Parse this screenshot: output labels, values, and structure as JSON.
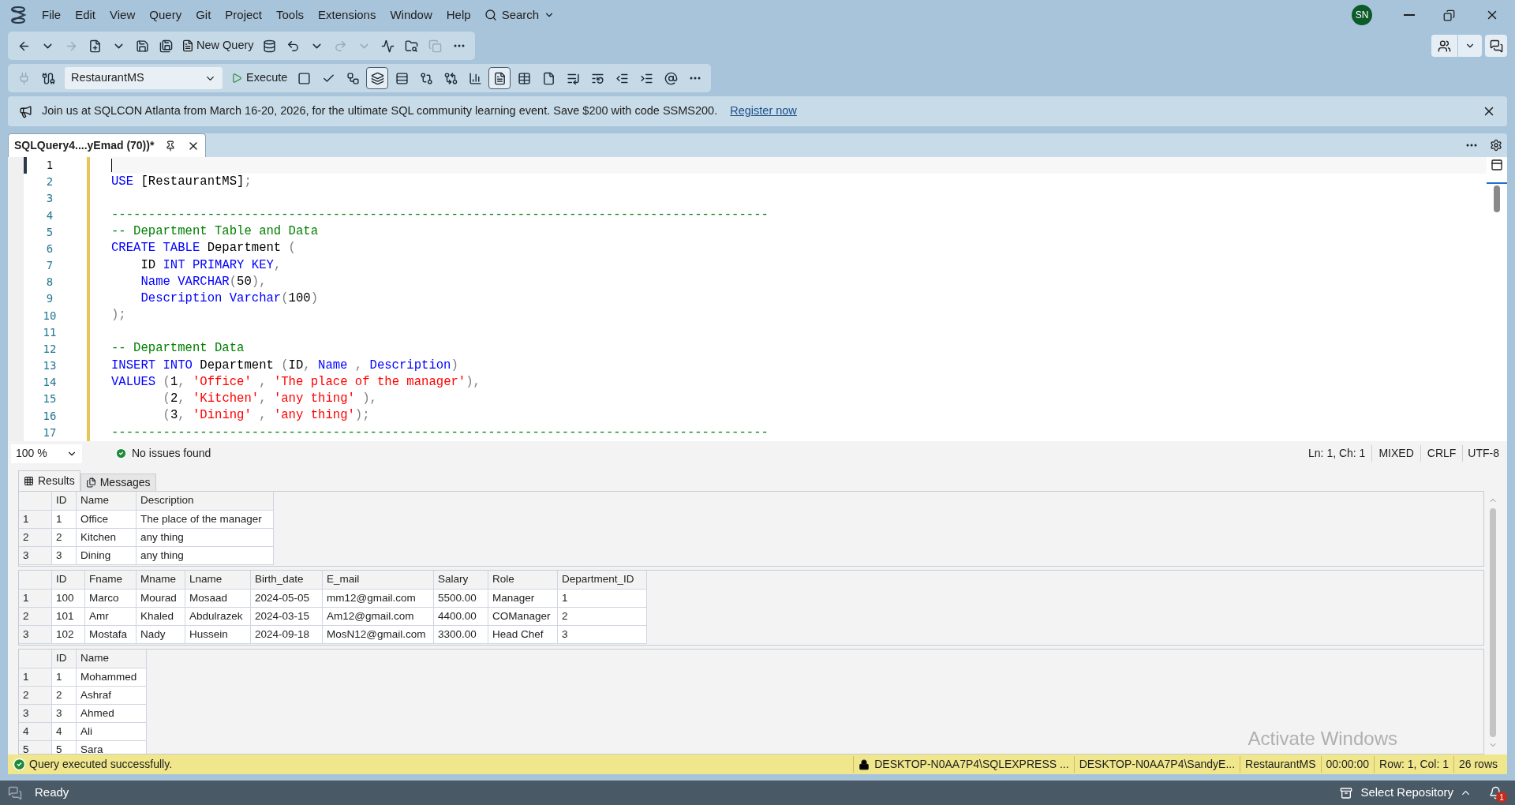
{
  "menu": {
    "items": [
      "File",
      "Edit",
      "View",
      "Query",
      "Git",
      "Project",
      "Tools",
      "Extensions",
      "Window",
      "Help"
    ],
    "search": "Search",
    "avatar": "SN"
  },
  "toolbar_1": {
    "buttons": [
      {
        "disabled": false
      },
      {
        "disabled": false
      },
      {
        "disabled": true
      },
      {
        "disabled": false
      },
      {
        "disabled": false
      },
      {
        "disabled": false
      },
      {
        "disabled": false
      }
    ],
    "new_query": "New Query",
    "after": [
      {
        "disabled": false
      },
      {
        "disabled": false
      },
      {
        "disabled": false
      },
      {
        "disabled": true
      },
      {
        "disabled": true
      },
      {
        "disabled": false
      },
      {
        "disabled": false
      },
      {
        "disabled": true
      },
      {
        "disabled": false
      }
    ]
  },
  "toolbar_2": {
    "database": "RestaurantMS",
    "execute": "Execute",
    "buttons": [
      {
        "selected": false
      },
      {
        "selected": false
      },
      {
        "selected": false
      },
      {
        "selected": true
      },
      {
        "selected": false
      },
      {
        "selected": false
      },
      {
        "selected": false
      },
      {
        "selected": false
      },
      {
        "selected": true
      },
      {
        "selected": false
      },
      {
        "selected": false
      },
      {
        "selected": false
      },
      {
        "selected": false
      },
      {
        "selected": false
      },
      {
        "selected": false
      },
      {
        "selected": false
      }
    ]
  },
  "banner": {
    "text": "Join us at SQLCON Atlanta from March 16-20, 2026, for the ultimate SQL community learning event. Save $200 with code SSMS200.",
    "link": "Register now"
  },
  "document_tab": {
    "title": "SQLQuery4....yEmad (70))*",
    "selected": true
  },
  "editor": {
    "lines": [
      {
        "n": "1",
        "current": true
      },
      {
        "n": "2",
        "current": false,
        "tokens": [
          {
            "kind": "keyword",
            "t": "USE"
          },
          {
            "kind": "plain",
            "t": " [RestaurantMS]"
          },
          {
            "kind": "punct",
            "t": ";"
          }
        ]
      },
      {
        "n": "3",
        "current": false
      },
      {
        "n": "4",
        "current": false,
        "tokens": [
          {
            "kind": "comment",
            "t": "-----------------------------------------------------------------------------------------"
          }
        ]
      },
      {
        "n": "5",
        "current": false,
        "tokens": [
          {
            "kind": "comment",
            "t": "-- Department Table and Data"
          }
        ]
      },
      {
        "n": "6",
        "current": false,
        "tokens": [
          {
            "kind": "keyword",
            "t": "CREATE TABLE"
          },
          {
            "kind": "plain",
            "t": " Department "
          },
          {
            "kind": "punct",
            "t": "("
          }
        ]
      },
      {
        "n": "7",
        "current": false,
        "tokens": [
          {
            "kind": "plain",
            "t": "    ID "
          },
          {
            "kind": "keyword",
            "t": "INT PRIMARY KEY"
          },
          {
            "kind": "punct",
            "t": ","
          }
        ]
      },
      {
        "n": "8",
        "current": false,
        "tokens": [
          {
            "kind": "keyword",
            "t": "    Name VARCHAR"
          },
          {
            "kind": "punct",
            "t": "("
          },
          {
            "kind": "plain",
            "t": "50"
          },
          {
            "kind": "punct",
            "t": "),"
          }
        ]
      },
      {
        "n": "9",
        "current": false,
        "tokens": [
          {
            "kind": "keyword",
            "t": "    Description Varchar"
          },
          {
            "kind": "punct",
            "t": "("
          },
          {
            "kind": "plain",
            "t": "100"
          },
          {
            "kind": "punct",
            "t": ")"
          }
        ]
      },
      {
        "n": "10",
        "current": false,
        "tokens": [
          {
            "kind": "punct",
            "t": ");"
          }
        ]
      },
      {
        "n": "11",
        "current": false
      },
      {
        "n": "12",
        "current": false,
        "tokens": [
          {
            "kind": "comment",
            "t": "-- Department Data"
          }
        ]
      },
      {
        "n": "13",
        "current": false,
        "tokens": [
          {
            "kind": "keyword",
            "t": "INSERT INTO"
          },
          {
            "kind": "plain",
            "t": " Department "
          },
          {
            "kind": "punct",
            "t": "("
          },
          {
            "kind": "plain",
            "t": "ID"
          },
          {
            "kind": "punct",
            "t": ","
          },
          {
            "kind": "keyword",
            "t": " Name "
          },
          {
            "kind": "punct",
            "t": ","
          },
          {
            "kind": "keyword",
            "t": " Description"
          },
          {
            "kind": "punct",
            "t": ")"
          }
        ]
      },
      {
        "n": "14",
        "current": false,
        "tokens": [
          {
            "kind": "keyword",
            "t": "VALUES"
          },
          {
            "kind": "punct",
            "t": " ("
          },
          {
            "kind": "plain",
            "t": "1"
          },
          {
            "kind": "punct",
            "t": ", "
          },
          {
            "kind": "string",
            "t": "'Office'"
          },
          {
            "kind": "punct",
            "t": " , "
          },
          {
            "kind": "string",
            "t": "'The place of the manager'"
          },
          {
            "kind": "punct",
            "t": "),"
          }
        ]
      },
      {
        "n": "15",
        "current": false,
        "tokens": [
          {
            "kind": "punct",
            "t": "       ("
          },
          {
            "kind": "plain",
            "t": "2"
          },
          {
            "kind": "punct",
            "t": ", "
          },
          {
            "kind": "string",
            "t": "'Kitchen'"
          },
          {
            "kind": "punct",
            "t": ", "
          },
          {
            "kind": "string",
            "t": "'any thing'"
          },
          {
            "kind": "punct",
            "t": " ),"
          }
        ]
      },
      {
        "n": "16",
        "current": false,
        "tokens": [
          {
            "kind": "punct",
            "t": "       ("
          },
          {
            "kind": "plain",
            "t": "3"
          },
          {
            "kind": "punct",
            "t": ", "
          },
          {
            "kind": "string",
            "t": "'Dining'"
          },
          {
            "kind": "punct",
            "t": " , "
          },
          {
            "kind": "string",
            "t": "'any thing'"
          },
          {
            "kind": "punct",
            "t": ");"
          }
        ]
      },
      {
        "n": "17",
        "current": false,
        "tokens": [
          {
            "kind": "comment",
            "t": "-----------------------------------------------------------------------------------------"
          }
        ]
      }
    ]
  },
  "editor_status": {
    "zoom": "100 %",
    "issues": "No issues found",
    "position": "Ln: 1, Ch: 1",
    "whitespace": "MIXED",
    "line_endings": "CRLF",
    "encoding": "UTF-8"
  },
  "results_tabs": [
    {
      "label": "Results",
      "selected": true
    },
    {
      "label": "Messages",
      "selected": false
    }
  ],
  "grids": [
    {
      "columns": [
        "",
        "ID",
        "Name",
        "Description"
      ],
      "rows": [
        [
          "1",
          "1",
          "Office",
          "The place of the manager"
        ],
        [
          "2",
          "2",
          "Kitchen",
          "any thing"
        ],
        [
          "3",
          "3",
          "Dining",
          "any thing"
        ]
      ]
    },
    {
      "columns": [
        "",
        "ID",
        "Fname",
        "Mname",
        "Lname",
        "Birth_date",
        "E_mail",
        "Salary",
        "Role",
        "Department_ID"
      ],
      "rows": [
        [
          "1",
          "100",
          "Marco",
          "Mourad",
          "Mosaad",
          "2024-05-05",
          "mm12@gmail.com",
          "5500.00",
          "Manager",
          "1"
        ],
        [
          "2",
          "101",
          "Amr",
          "Khaled",
          "Abdulrazek",
          "2024-03-15",
          "Am12@gmail.com",
          "4400.00",
          "COManager",
          "2"
        ],
        [
          "3",
          "102",
          "Mostafa",
          "Nady",
          "Hussein",
          "2024-09-18",
          "MosN12@gmail.com",
          "3300.00",
          "Head Chef",
          "3"
        ]
      ]
    },
    {
      "columns": [
        "",
        "ID",
        "Name"
      ],
      "rows": [
        [
          "1",
          "1",
          "Mohammed"
        ],
        [
          "2",
          "2",
          "Ashraf"
        ],
        [
          "3",
          "3",
          "Ahmed"
        ],
        [
          "4",
          "4",
          "Ali"
        ],
        [
          "5",
          "5",
          "Sara"
        ]
      ]
    }
  ],
  "activation_notice": "Activate Windows",
  "query_status": {
    "message": "Query executed successfully.",
    "server": "DESKTOP-N0AA7P4\\SQLEXPRESS ...",
    "user": "DESKTOP-N0AA7P4\\SandyE...",
    "database": "RestaurantMS",
    "elapsed": "00:00:00",
    "position": "Row: 1, Col: 1",
    "rows": "26 rows"
  },
  "status_bar": {
    "state": "Ready",
    "repository": "Select Repository",
    "notifications": "1"
  }
}
